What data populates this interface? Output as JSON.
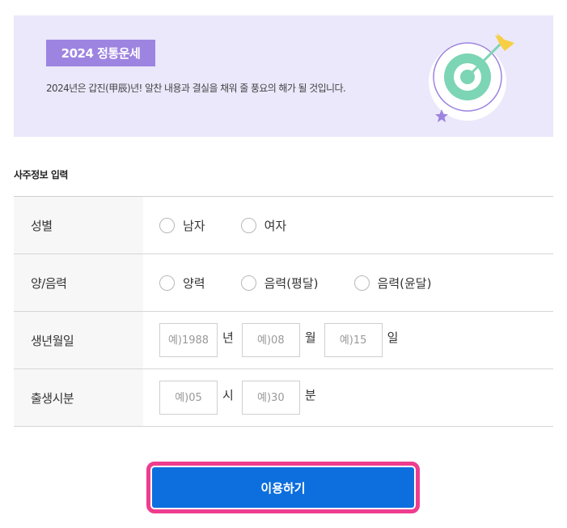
{
  "banner": {
    "badge": "2024 정통운세",
    "description": "2024년은 갑진(甲辰)년! 알찬 내용과 결실을 채워 줄 풍요의 해가 될 것입니다.",
    "illustration": "target-icon"
  },
  "form": {
    "section_title": "사주정보 입력",
    "gender": {
      "label": "성별",
      "options": [
        "남자",
        "여자"
      ]
    },
    "calendar": {
      "label": "양/음력",
      "options": [
        "양력",
        "음력(평달)",
        "음력(윤달)"
      ]
    },
    "birthdate": {
      "label": "생년월일",
      "year_placeholder": "예)1988",
      "year_unit": "년",
      "month_placeholder": "예)08",
      "month_unit": "월",
      "day_placeholder": "예)15",
      "day_unit": "일"
    },
    "birthtime": {
      "label": "출생시분",
      "hour_placeholder": "예)05",
      "hour_unit": "시",
      "minute_placeholder": "예)30",
      "minute_unit": "분"
    }
  },
  "submit": {
    "label": "이용하기"
  },
  "colors": {
    "banner_bg": "#ebe8fb",
    "badge_bg": "#9d84e0",
    "button_bg": "#0d6fdd",
    "highlight": "#ee3d8e"
  }
}
